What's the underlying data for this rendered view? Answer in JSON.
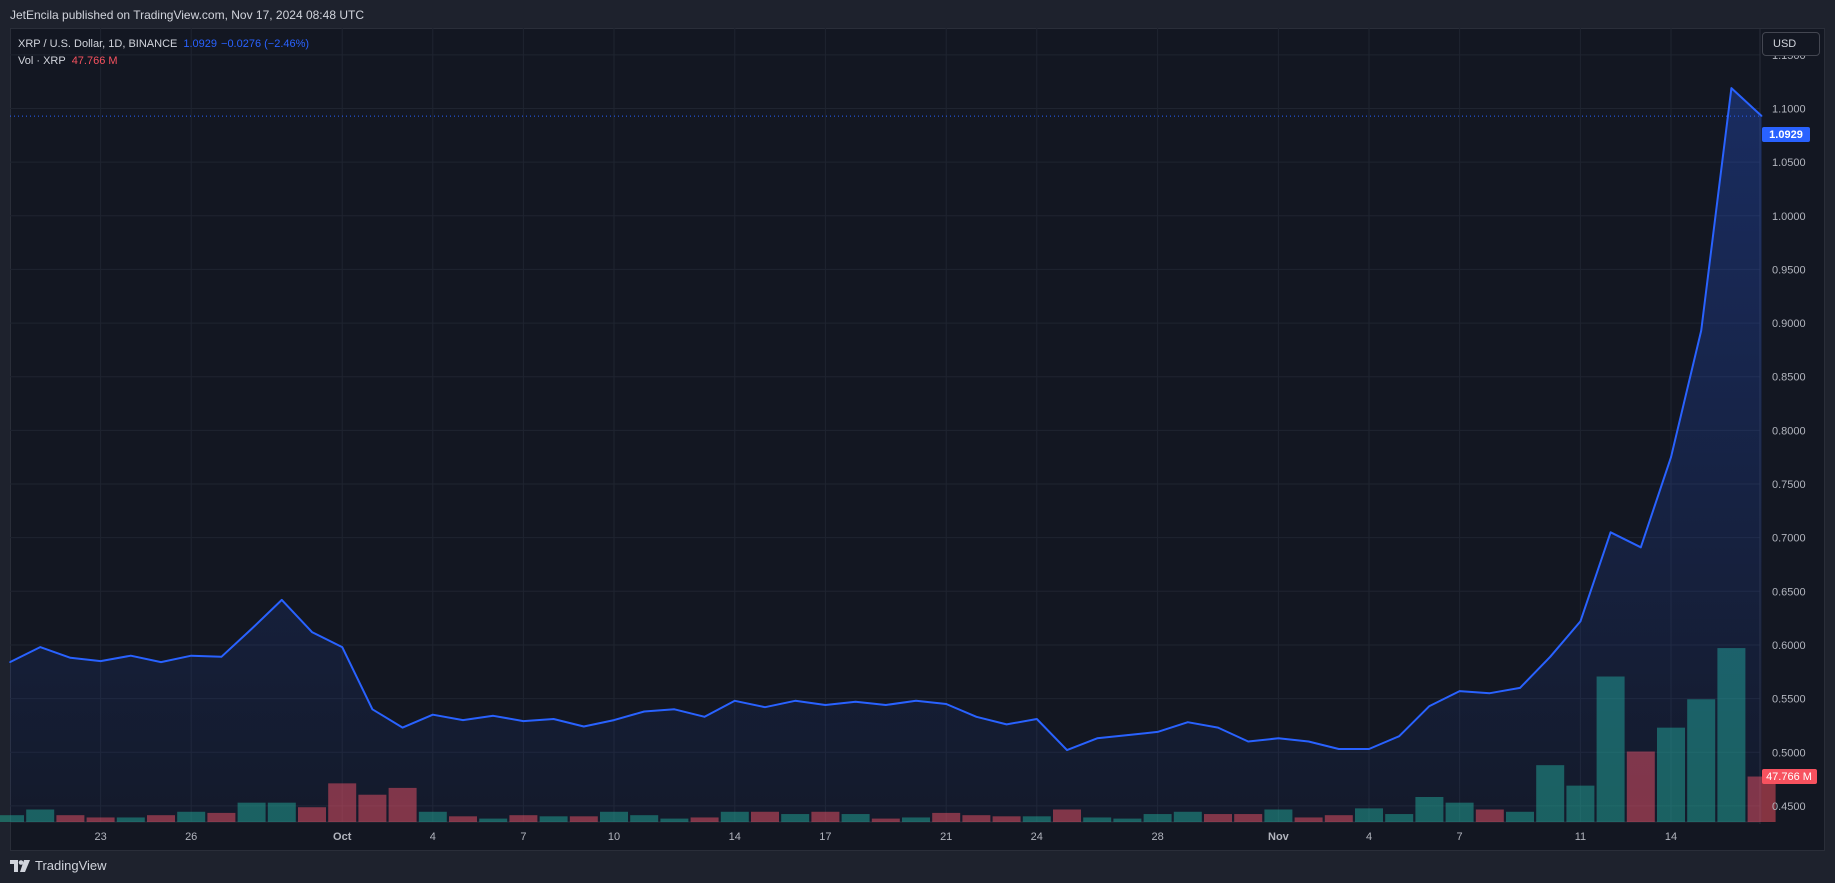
{
  "header": {
    "publish_text": "JetEncila published on TradingView.com, Nov 17, 2024 08:48 UTC"
  },
  "legend": {
    "symbol": "XRP / U.S. Dollar, 1D, BINANCE",
    "last": "1.0929",
    "change": "−0.0276 (−2.46%)",
    "vol_label": "Vol · XRP",
    "vol_value": "47.766 M"
  },
  "toolbar": {
    "currency": "USD"
  },
  "badges": {
    "price": "1.0929",
    "volume": "47.766 M"
  },
  "footer": {
    "brand": "TradingView"
  },
  "colors": {
    "line": "#2962ff",
    "vol_up": "#22ab94",
    "vol_down": "#f7525f",
    "background": "#131722",
    "grid": "#1f2430"
  },
  "chart_data": {
    "type": "area",
    "x_tick_labels": [
      "23",
      "26",
      "Oct",
      "4",
      "7",
      "10",
      "14",
      "17",
      "21",
      "24",
      "28",
      "Nov",
      "4",
      "7",
      "11",
      "14"
    ],
    "y_tick_labels": [
      "1.1500",
      "1.1000",
      "1.0500",
      "1.0000",
      "0.9500",
      "0.9000",
      "0.8500",
      "0.8000",
      "0.7500",
      "0.7000",
      "0.6500",
      "0.6000",
      "0.5500",
      "0.5000",
      "0.4500"
    ],
    "ylim": [
      0.435,
      1.175
    ],
    "grid": true,
    "series": [
      {
        "dates": [
          "Sep 20",
          "Sep 21",
          "Sep 22",
          "Sep 23",
          "Sep 24",
          "Sep 25",
          "Sep 26",
          "Sep 27",
          "Sep 28",
          "Sep 29",
          "Sep 30",
          "Oct 1",
          "Oct 2",
          "Oct 3",
          "Oct 4",
          "Oct 5",
          "Oct 6",
          "Oct 7",
          "Oct 8",
          "Oct 9",
          "Oct 10",
          "Oct 11",
          "Oct 12",
          "Oct 13",
          "Oct 14",
          "Oct 15",
          "Oct 16",
          "Oct 17",
          "Oct 18",
          "Oct 19",
          "Oct 20",
          "Oct 21",
          "Oct 22",
          "Oct 23",
          "Oct 24",
          "Oct 25",
          "Oct 26",
          "Oct 27",
          "Oct 28",
          "Oct 29",
          "Oct 30",
          "Oct 31",
          "Nov 1",
          "Nov 2",
          "Nov 3",
          "Nov 4",
          "Nov 5",
          "Nov 6",
          "Nov 7",
          "Nov 8",
          "Nov 9",
          "Nov 10",
          "Nov 11",
          "Nov 12",
          "Nov 13",
          "Nov 14",
          "Nov 15",
          "Nov 16",
          "Nov 17"
        ],
        "values": [
          0.584,
          0.598,
          0.588,
          0.585,
          0.59,
          0.584,
          0.59,
          0.589,
          0.615,
          0.642,
          0.612,
          0.598,
          0.54,
          0.523,
          0.535,
          0.53,
          0.534,
          0.529,
          0.531,
          0.524,
          0.53,
          0.538,
          0.54,
          0.533,
          0.548,
          0.542,
          0.548,
          0.544,
          0.547,
          0.544,
          0.548,
          0.545,
          0.533,
          0.526,
          0.531,
          0.502,
          0.513,
          0.516,
          0.519,
          0.528,
          0.523,
          0.51,
          0.513,
          0.51,
          0.503,
          0.503,
          0.515,
          0.543,
          0.557,
          0.555,
          0.56,
          0.589,
          0.622,
          0.705,
          0.691,
          0.775,
          0.893,
          1.119,
          1.093
        ]
      }
    ],
    "volume": {
      "label": "Vol · XRP",
      "unit": "M",
      "values": [
        6,
        11,
        6,
        4,
        4,
        6,
        9,
        8,
        17,
        17,
        13,
        34,
        24,
        30,
        9,
        5,
        3,
        6,
        5,
        5,
        9,
        6,
        3,
        4,
        9,
        9,
        7,
        9,
        7,
        3,
        4,
        8,
        6,
        5,
        5,
        11,
        4,
        3,
        7,
        9,
        7,
        7,
        11,
        4,
        6,
        12,
        7,
        22,
        17,
        11,
        9,
        50,
        32,
        128,
        62,
        83,
        108,
        153,
        40
      ],
      "directions": [
        "u",
        "u",
        "d",
        "d",
        "u",
        "d",
        "u",
        "d",
        "u",
        "u",
        "d",
        "d",
        "d",
        "d",
        "u",
        "d",
        "u",
        "d",
        "u",
        "d",
        "u",
        "u",
        "u",
        "d",
        "u",
        "d",
        "u",
        "d",
        "u",
        "d",
        "u",
        "d",
        "d",
        "d",
        "u",
        "d",
        "u",
        "u",
        "u",
        "u",
        "d",
        "d",
        "u",
        "d",
        "d",
        "u",
        "u",
        "u",
        "u",
        "d",
        "u",
        "u",
        "u",
        "u",
        "d",
        "u",
        "u",
        "u",
        "d"
      ]
    }
  }
}
